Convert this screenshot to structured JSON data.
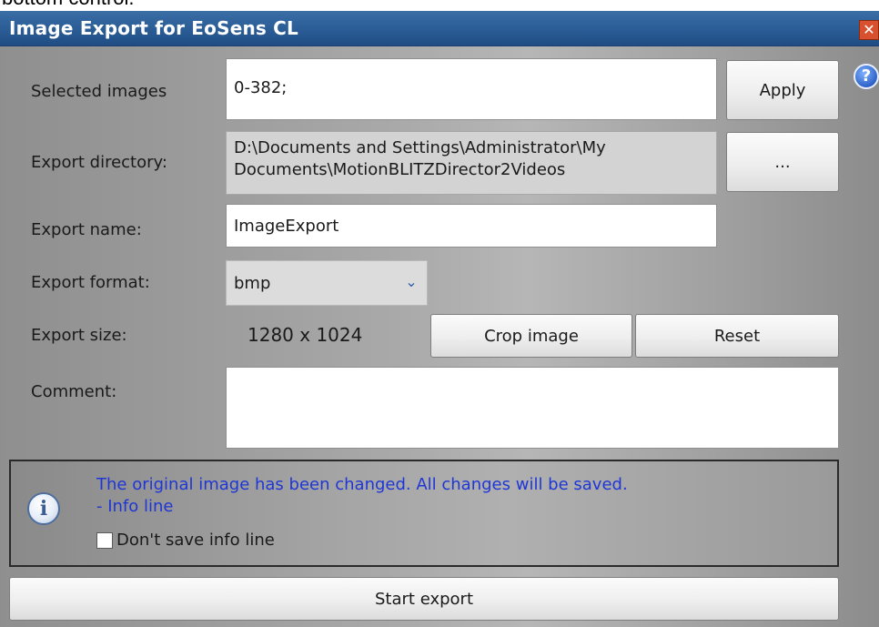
{
  "top_strip_text": "bottom control.",
  "window": {
    "title": "Image Export for EoSens CL",
    "close_glyph": "✕",
    "help_glyph": "?"
  },
  "form": {
    "selected_images": {
      "label": "Selected images",
      "value": "0-382;",
      "button": "Apply"
    },
    "export_directory": {
      "label": "Export directory:",
      "value": "D:\\Documents and Settings\\Administrator\\My Documents\\MotionBLITZDirector2Videos",
      "button": "..."
    },
    "export_name": {
      "label": "Export name:",
      "value": "ImageExport"
    },
    "export_format": {
      "label": "Export format:",
      "value": "bmp",
      "arrow": "⌄"
    },
    "export_size": {
      "label": "Export size:",
      "value": "1280 x 1024",
      "crop_button": "Crop image",
      "reset_button": "Reset"
    },
    "comment": {
      "label": "Comment:",
      "value": ""
    }
  },
  "info": {
    "icon_glyph": "i",
    "message": "The original image has been changed. All changes will be saved.",
    "line": "- Info line",
    "checkbox_label": "Don't save info line",
    "checkbox_checked": false
  },
  "actions": {
    "start_export": "Start export"
  },
  "colors": {
    "title_bar": "#2d5f98",
    "info_text": "#1f36d6"
  }
}
